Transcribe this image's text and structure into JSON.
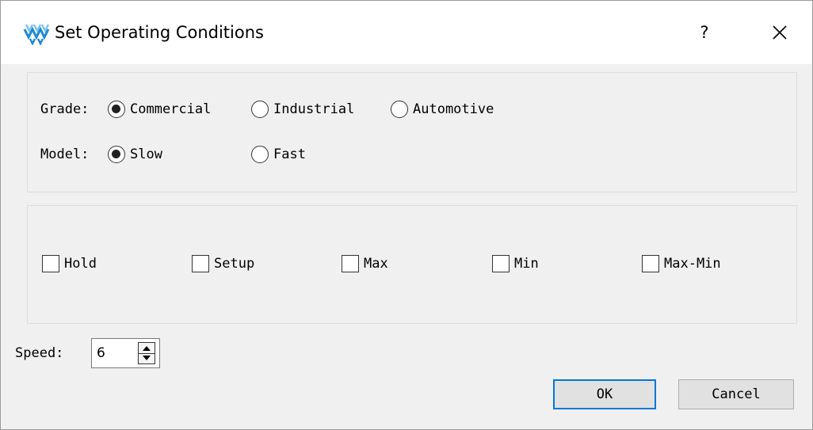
{
  "window": {
    "title": "Set Operating Conditions",
    "help_label": "?"
  },
  "grade": {
    "label": "Grade:",
    "options": [
      {
        "label": "Commercial",
        "selected": true
      },
      {
        "label": "Industrial",
        "selected": false
      },
      {
        "label": "Automotive",
        "selected": false
      }
    ]
  },
  "model": {
    "label": "Model:",
    "options": [
      {
        "label": "Slow",
        "selected": true
      },
      {
        "label": "Fast",
        "selected": false
      }
    ]
  },
  "checks": [
    {
      "label": "Hold",
      "checked": false
    },
    {
      "label": "Setup",
      "checked": false
    },
    {
      "label": "Max",
      "checked": false
    },
    {
      "label": "Min",
      "checked": false
    },
    {
      "label": "Max-Min",
      "checked": false
    }
  ],
  "speed": {
    "label": "Speed:",
    "value": "6"
  },
  "buttons": {
    "ok": "OK",
    "cancel": "Cancel"
  },
  "colors": {
    "accent": "#0078d7",
    "icon_blue": "#1e88d6",
    "icon_light": "#7cc4f0"
  },
  "icons": {
    "app": "gowin-logo-icon",
    "close": "close-icon",
    "spin": "spin-arrows-icon"
  }
}
